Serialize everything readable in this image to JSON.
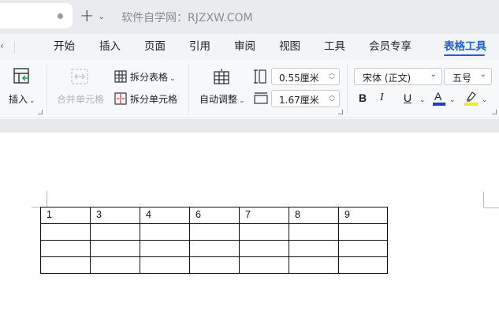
{
  "titlebar": {
    "site_title": "软件自学网：RJZXW.COM"
  },
  "menu": {
    "items": [
      "开始",
      "插入",
      "页面",
      "引用",
      "审阅",
      "视图",
      "工具",
      "会员专享",
      "表格工具"
    ],
    "active": "表格工具"
  },
  "ribbon": {
    "insert_label": "插入",
    "merge_cells_label": "合并单元格",
    "split_table_label": "拆分表格",
    "split_cells_label": "拆分单元格",
    "autofit_label": "自动调整",
    "row_height": "0.55厘米",
    "col_width": "1.67厘米",
    "font_name": "宋体 (正文)",
    "font_size": "五号",
    "bold": "B",
    "italic": "I",
    "underline": "U",
    "font_color_letter": "A",
    "colors": {
      "font_color": "#1b3fd6",
      "highlight": "#f2ee12",
      "accent": "#1a5fe0"
    }
  },
  "table": {
    "header_row": [
      "1",
      "3",
      "4",
      "6",
      "7",
      "8",
      "9"
    ],
    "empty_rows": 3
  }
}
